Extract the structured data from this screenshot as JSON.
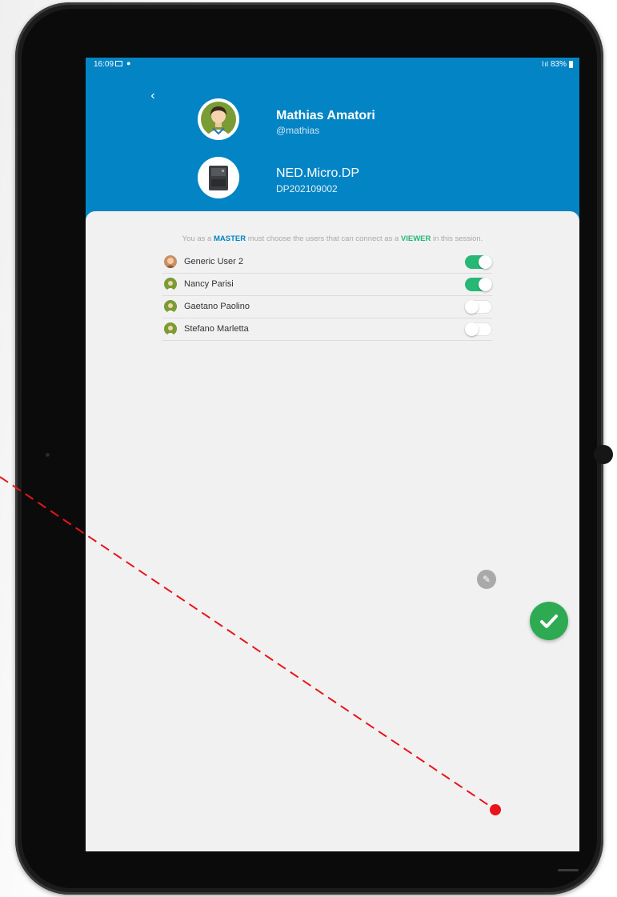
{
  "status_bar": {
    "time": "16:09",
    "battery": "83%",
    "signal_icon": "wifi-signal-icon",
    "gallery_icon": "image-icon",
    "notification_icon": "bulb-icon"
  },
  "header": {
    "back_icon": "chevron-left-icon",
    "user_name": "Mathias Amatori",
    "user_handle": "@mathias",
    "device_name": "NED.Micro.DP",
    "device_serial": "DP202109002"
  },
  "instructions": {
    "part1": "You as a ",
    "master": "MASTER",
    "part2": " must choose the users that can connect as a ",
    "viewer": "VIEWER",
    "part3": " in this session."
  },
  "users": [
    {
      "name": "Generic User 2",
      "enabled": true
    },
    {
      "name": "Nancy Parisi",
      "enabled": true
    },
    {
      "name": "Gaetano Paolino",
      "enabled": false
    },
    {
      "name": "Stefano Marletta",
      "enabled": false
    }
  ],
  "actions": {
    "confirm_icon": "check-icon",
    "edit_icon": "pencil-icon"
  },
  "colors": {
    "header_blue": "#0384c4",
    "toggle_on": "#27b876",
    "confirm_green": "#2eaa52",
    "annotation_red": "#e8141a"
  }
}
